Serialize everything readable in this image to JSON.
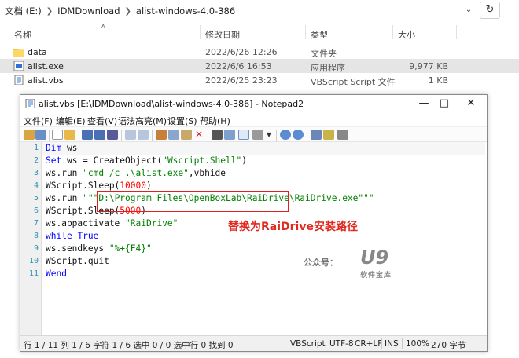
{
  "explorer": {
    "breadcrumb": [
      "文档 (E:)",
      "IDMDownload",
      "alist-windows-4.0-386"
    ],
    "columns": {
      "name": "名称",
      "date": "修改日期",
      "type": "类型",
      "size": "大小"
    },
    "files": [
      {
        "name": "data",
        "date": "2022/6/26 12:26",
        "type": "文件夹",
        "size": ""
      },
      {
        "name": "alist.exe",
        "date": "2022/6/6 16:53",
        "type": "应用程序",
        "size": "9,977 KB"
      },
      {
        "name": "alist.vbs",
        "date": "2022/6/25 23:23",
        "type": "VBScript Script 文件",
        "size": "1 KB"
      }
    ]
  },
  "notepad": {
    "title": "alist.vbs [E:\\IDMDownload\\alist-windows-4.0-386] - Notepad2",
    "menu": [
      "文件(F)",
      "编辑(E)",
      "查看(V)",
      "语法高亮(M)",
      "设置(S)",
      "帮助(H)"
    ],
    "line_numbers": [
      "1",
      "2",
      "3",
      "4",
      "5",
      "6",
      "7",
      "8",
      "9",
      "10",
      "11"
    ],
    "code": {
      "l1_kw": "Dim",
      "l1_rest": " ws",
      "l2_kw": "Set",
      "l2_a": " ws = CreateObject(",
      "l2_str": "\"Wscript.Shell\"",
      "l2_b": ")",
      "l3_a": "ws.run ",
      "l3_str": "\"cmd /c .\\alist.exe\"",
      "l3_b": ",vbhide",
      "l4_a": "WScript.Sleep(",
      "l4_num": "10000",
      "l4_b": ")",
      "l5_a": "ws.run ",
      "l5_str": "\"\"\"D:\\Program Files\\OpenBoxLab\\RaiDrive\\RaiDrive.exe\"\"\"",
      "l6_a": "WScript.Sleep(",
      "l6_num": "5000",
      "l6_b": ")",
      "l7_a": "ws.appactivate ",
      "l7_str": "\"RaiDrive\"",
      "l8_kw": "while",
      "l8_kw2": "True",
      "l9_a": "ws.sendkeys ",
      "l9_str": "\"%+{F4}\"",
      "l10_a": "WScript.quit",
      "l11_kw": "Wend"
    },
    "annotation": "替换为RaiDrive安装路径",
    "watermark": {
      "label": "公众号：",
      "logo": "U9",
      "sub": "软件宝库"
    },
    "status": {
      "position": "行 1 / 11  列 1 / 6  字符 1 / 6  选中 0 / 0  选中行 0  找到 0",
      "lang": "VBScript",
      "encoding": "UTF-8",
      "eol": "CR+LF",
      "ins": "INS",
      "zoom": "100%",
      "bytes": "270 字节"
    }
  }
}
